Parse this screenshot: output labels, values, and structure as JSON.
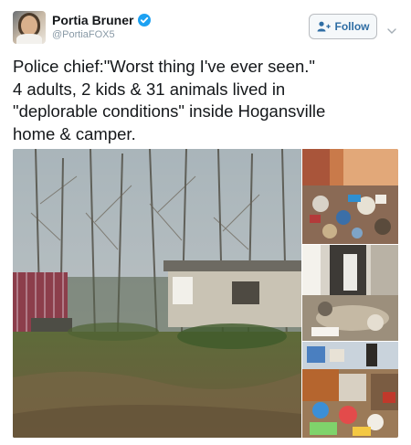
{
  "author": {
    "display_name": "Portia Bruner",
    "handle": "@PortiaFOX5",
    "verified_icon": "verified-badge-icon",
    "avatar_icon": "profile-photo"
  },
  "follow_button": {
    "label": "Follow",
    "icon": "add-user-icon"
  },
  "menu_icon": "chevron-down-icon",
  "tweet": {
    "text": "Police chief:\"Worst thing I've ever seen.\"\n4 adults, 2 kids & 31 animals lived in\n\"deplorable conditions\" inside Hogansville\nhome & camper."
  },
  "media": {
    "photo_count": 4
  },
  "colors": {
    "accent": "#1da1f2",
    "follow_text": "#2e6da4",
    "handle": "#8899a6",
    "text": "#14171a"
  }
}
